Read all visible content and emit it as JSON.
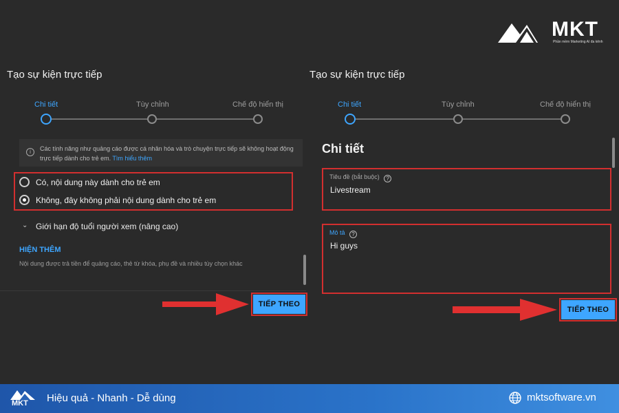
{
  "brand": {
    "name": "MKT",
    "tagline": "Phần mềm Marketing AI đa kênh"
  },
  "left_panel": {
    "title": "Tạo sự kiện trực tiếp",
    "steps": [
      "Chi tiết",
      "Tùy chỉnh",
      "Chế độ hiển thị"
    ],
    "active_step": 0,
    "info": {
      "text": "Các tính năng như quảng cáo được cá nhân hóa và trò chuyện trực tiếp sẽ không hoạt động trực tiếp dành cho trẻ em.",
      "link": "Tìm hiểu thêm"
    },
    "radio_options": [
      {
        "label": "Có, nội dung này dành cho trẻ em",
        "checked": false
      },
      {
        "label": "Không, đây không phải nội dung dành cho trẻ em",
        "checked": true
      }
    ],
    "age_restriction": "Giới hạn độ tuổi người xem (nâng cao)",
    "show_more": "HIỆN THÊM",
    "show_more_desc": "Nội dung được trả tiền để quảng cáo, thẻ từ khóa, phụ đề và nhiều tùy chọn khác",
    "next_button": "TIẾP THEO"
  },
  "right_panel": {
    "title": "Tạo sự kiện trực tiếp",
    "steps": [
      "Chi tiết",
      "Tùy chỉnh",
      "Chế độ hiển thị"
    ],
    "active_step": 0,
    "section_title": "Chi tiết",
    "title_field": {
      "label": "Tiêu đề (bắt buộc)",
      "value": "Livestream"
    },
    "description_field": {
      "label": "Mô tả",
      "value": "Hi guys"
    },
    "next_button": "TIẾP THEO"
  },
  "footer": {
    "slogan": "Hiệu quả - Nhanh - Dễ dùng",
    "website": "mktsoftware.vn",
    "logo_text": "MKT"
  },
  "colors": {
    "background": "#2a2a2a",
    "accent": "#3ea6ff",
    "highlight": "#d32f2f",
    "footer": "#2a73c9"
  }
}
